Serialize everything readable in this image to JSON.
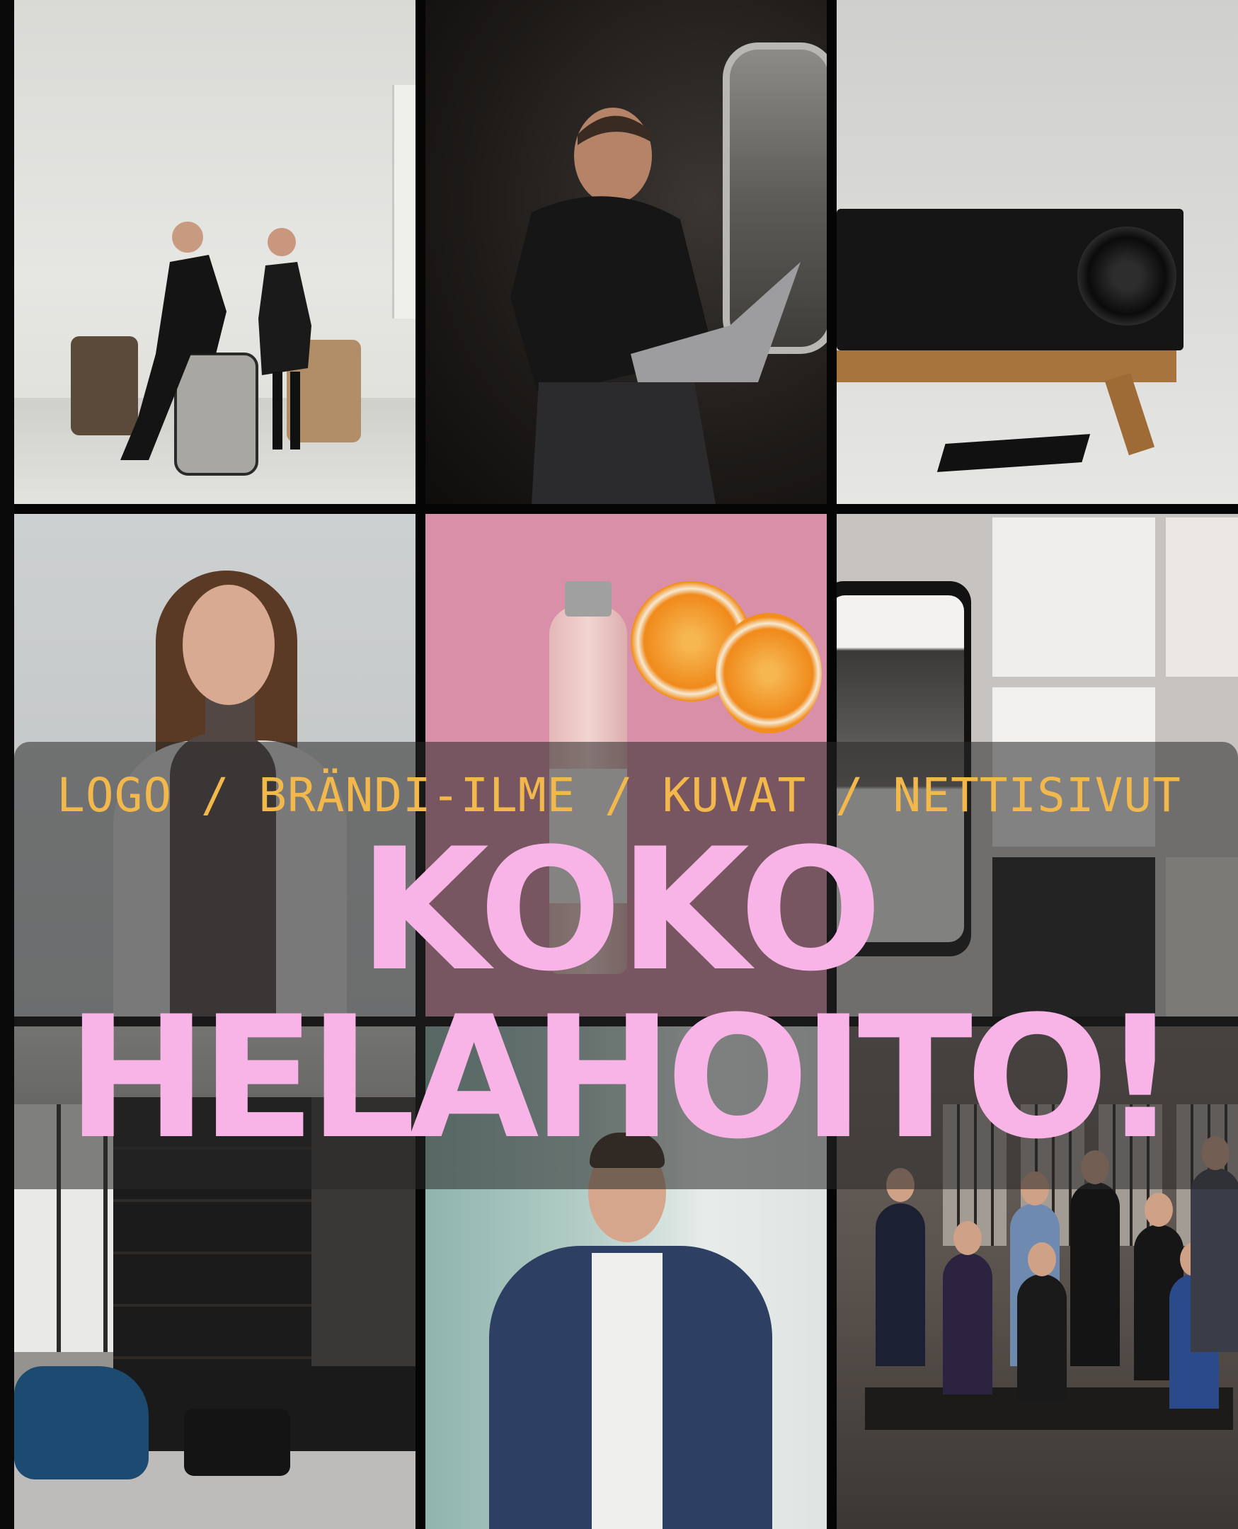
{
  "subtitle": "LOGO / BRÄNDI-ILME / KUVAT / NETTISIVUT",
  "headline": {
    "line1": "KOKO",
    "line2": "HELAHOITO!"
  },
  "colors": {
    "subtitle": "#f2b84b",
    "headline": "#f8b4e6",
    "overlay": "rgba(40,40,40,0.55)",
    "grid_gap": "#050505"
  },
  "photos": [
    {
      "name": "photo-duo-studio"
    },
    {
      "name": "photo-man-train-laptop"
    },
    {
      "name": "photo-speaker-furniture"
    },
    {
      "name": "photo-woman-portrait"
    },
    {
      "name": "photo-seltzer-oranges"
    },
    {
      "name": "photo-website-mockup"
    },
    {
      "name": "photo-interior-shelving"
    },
    {
      "name": "photo-man-suit-portrait"
    },
    {
      "name": "photo-team-group"
    }
  ]
}
